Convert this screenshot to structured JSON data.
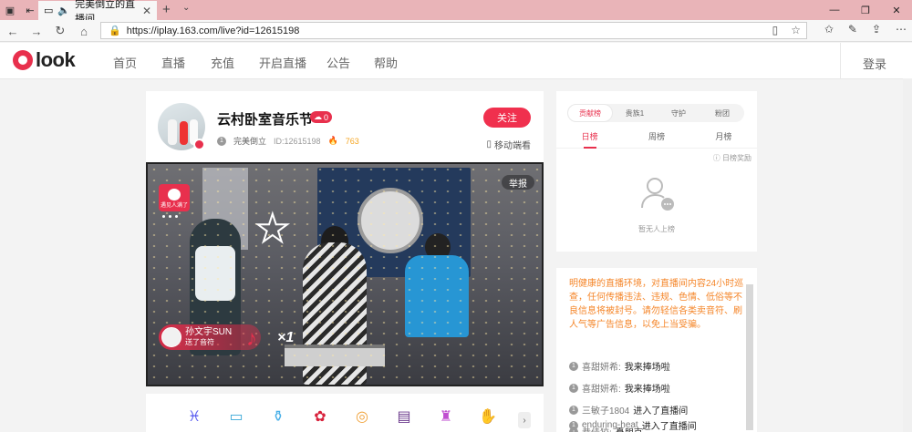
{
  "browser": {
    "tab_title": "完美倒立的直播间",
    "url": "https://iplay.163.com/live?id=12615198"
  },
  "site": {
    "logo_text": "look",
    "nav": [
      "首页",
      "直播",
      "充值",
      "开启直播",
      "公告",
      "帮助"
    ],
    "login_label": "登录"
  },
  "room": {
    "title": "云村卧室音乐节",
    "hot_count": "0",
    "host_level": "1",
    "host_name": "完美倒立",
    "room_id": "ID:12615198",
    "fire_count": "763",
    "follow_label": "关注",
    "mobile_label": "移动端看"
  },
  "video": {
    "report_label": "举报",
    "gift_card_text": "遇见人满了",
    "gift_sender": "孙文宇SUN",
    "gift_action": "送了音符",
    "gift_multiplier": "×1"
  },
  "ranking": {
    "tabs": [
      "贡献榜",
      "贵族1",
      "守护",
      "粉团"
    ],
    "subtabs": [
      "日榜",
      "周榜",
      "月榜"
    ],
    "rule_label": "日榜奖励",
    "empty_text": "暂无人上榜"
  },
  "chat": {
    "notice": "明健康的直播环境，对直播间内容24小时巡查，任何传播违法、违规、色情、低俗等不良信息将被封号。请勿轻信各类卖音符、刷人气等广告信息，以免上当受骗。",
    "messages": [
      {
        "level": "1",
        "user": "喜甜妍希:",
        "text": "我来捧场啦"
      },
      {
        "level": "1",
        "user": "喜甜妍希:",
        "text": "我来捧场啦"
      },
      {
        "level": "1",
        "user": "三敏子1804",
        "text": "进入了直播间"
      },
      {
        "level": "1",
        "user": "恭佳狡:",
        "text": "矗朋克"
      },
      {
        "level": "1",
        "user": "enduring-heat",
        "text": "进入了直播间"
      }
    ]
  },
  "colors": {
    "accent": "#e8304d",
    "titlebar": "#e9b4b8",
    "notice": "#f5862a"
  }
}
